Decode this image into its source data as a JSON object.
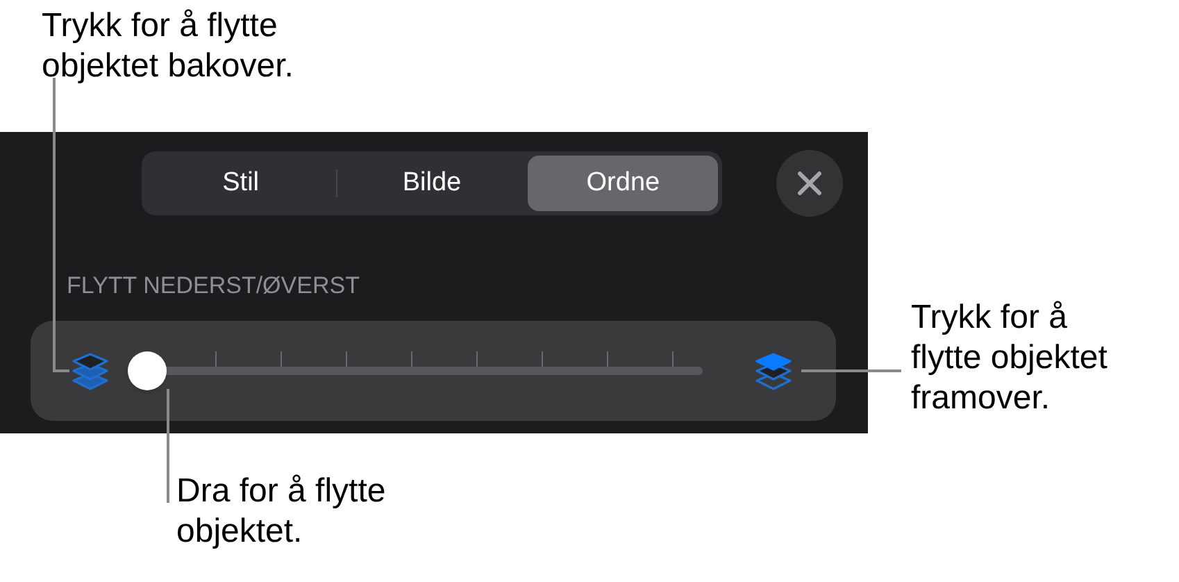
{
  "callouts": [
    {
      "kind": "top",
      "text": "Trykk for å flytte objektet bakover."
    },
    {
      "kind": "right",
      "text": "Trykk for å flytte objektet framover."
    },
    {
      "kind": "bottom",
      "text": "Dra for å flytte objektet."
    }
  ],
  "tabs": [
    {
      "label": "Stil",
      "selected": false
    },
    {
      "label": "Bilde",
      "selected": false
    },
    {
      "label": "Ordne",
      "selected": true
    }
  ],
  "section_label": "FLYTT NEDERST/ØVERST",
  "slider": {
    "level": 0
  }
}
